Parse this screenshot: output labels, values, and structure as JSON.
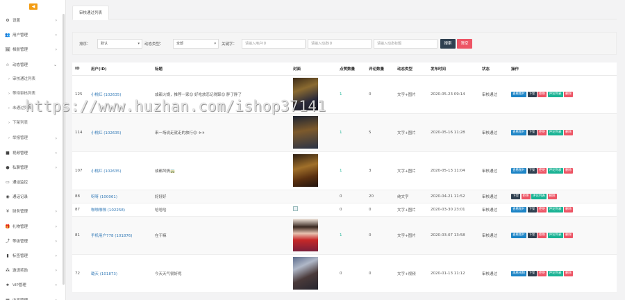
{
  "sidebar": {
    "collapse_icon": "◀",
    "items": [
      {
        "icon": "⚙",
        "label": "设置",
        "arrow": "›",
        "sub": false
      },
      {
        "icon": "👥",
        "label": "用户管理",
        "arrow": "›",
        "sub": false
      },
      {
        "icon": "🖼",
        "label": "相册管理",
        "arrow": "›",
        "sub": false
      },
      {
        "icon": "☆",
        "label": "动态管理",
        "arrow": "⌄",
        "sub": false
      },
      {
        "icon": "›",
        "label": "审核通过列表",
        "arrow": "",
        "sub": true
      },
      {
        "icon": "›",
        "label": "等待审核列表",
        "arrow": "",
        "sub": true
      },
      {
        "icon": "›",
        "label": "未通过列表",
        "arrow": "",
        "sub": true
      },
      {
        "icon": "›",
        "label": "下架列表",
        "arrow": "",
        "sub": true
      },
      {
        "icon": "›",
        "label": "举报管理",
        "arrow": "›",
        "sub": true
      },
      {
        "icon": "■",
        "label": "视频管理",
        "arrow": "›",
        "sub": false
      },
      {
        "icon": "●",
        "label": "私聊管理",
        "arrow": "›",
        "sub": false
      },
      {
        "icon": "▭",
        "label": "通话监控",
        "arrow": "",
        "sub": false
      },
      {
        "icon": "◉",
        "label": "通话记录",
        "arrow": "",
        "sub": false
      },
      {
        "icon": "¥",
        "label": "财务管理",
        "arrow": "›",
        "sub": false
      },
      {
        "icon": "🎁",
        "label": "礼物管理",
        "arrow": "›",
        "sub": false
      },
      {
        "icon": "⤴",
        "label": "等级管理",
        "arrow": "›",
        "sub": false
      },
      {
        "icon": "▮",
        "label": "标签管理",
        "arrow": "›",
        "sub": false
      },
      {
        "icon": "⁂",
        "label": "邀请奖励",
        "arrow": "›",
        "sub": false
      },
      {
        "icon": "★",
        "label": "VIP管理",
        "arrow": "›",
        "sub": false
      },
      {
        "icon": "▦",
        "label": "内容管理",
        "arrow": "›",
        "sub": false
      }
    ]
  },
  "tab": {
    "label": "审核通过列表"
  },
  "filter": {
    "sort_label": "排序：",
    "sort_value": "默认",
    "type_label": "动态类型：",
    "type_value": "全部",
    "keyword_label": "关键字：",
    "user_placeholder": "请输入用户ID",
    "id_placeholder": "请输入动态ID",
    "title_placeholder": "请输入动态标题",
    "search_label": "搜索",
    "clear_label": "清空",
    "caret": "▾"
  },
  "table": {
    "columns": [
      "ID",
      "用户(ID)",
      "标题",
      "封面",
      "点赞数量",
      "评论数量",
      "动态类型",
      "发布时间",
      "状态",
      "操作"
    ],
    "rows": [
      {
        "id": "125",
        "user": "小桃红 (102635)",
        "title": "成都火锅，推荐一家😊 好吃放恋记得踩😊 胖了胖了",
        "cover": "c1",
        "likes": "1",
        "comments": "0",
        "type": "文字+图片",
        "time": "2020-05-23 09:14",
        "status": "审核通过",
        "ops": [
          "查看图片",
          "下架",
          "拒绝",
          "评论列表",
          "删除"
        ]
      },
      {
        "id": "114",
        "user": "小桃红 (102635)",
        "title": "来一场说走就走的旅行😊 ✈✈",
        "cover": "c2",
        "likes": "1",
        "comments": "5",
        "type": "文字+图片",
        "time": "2020-05-16 11:28",
        "status": "审核通过",
        "ops": [
          "查看图片",
          "下架",
          "拒绝",
          "评论列表",
          "删除"
        ]
      },
      {
        "id": "107",
        "user": "小桃红 (102635)",
        "title": "成都风情🚃",
        "cover": "c3",
        "likes": "1",
        "comments": "3",
        "type": "文字+图片",
        "time": "2020-05-13 11:04",
        "status": "审核通过",
        "ops": [
          "查看图片",
          "下架",
          "拒绝",
          "评论列表",
          "删除"
        ]
      },
      {
        "id": "88",
        "user": "呀呀 (100061)",
        "title": "好好好",
        "cover": "",
        "likes": "0",
        "comments": "20",
        "type": "纯文字",
        "time": "2020-04-21 11:52",
        "status": "审核通过",
        "ops": [
          "下架",
          "拒绝",
          "评论列表",
          "删除"
        ]
      },
      {
        "id": "87",
        "user": "啪啪啪啪 (102258)",
        "title": "哈哈哈",
        "cover": "broken",
        "likes": "0",
        "comments": "0",
        "type": "文字+图片",
        "time": "2020-03-30 23:01",
        "status": "审核通过",
        "ops": [
          "查看图片",
          "下架",
          "拒绝",
          "评论列表",
          "删除"
        ]
      },
      {
        "id": "81",
        "user": "手机用户778 (101876)",
        "title": "在干嘛",
        "cover": "c4",
        "likes": "1",
        "comments": "0",
        "type": "文字+图片",
        "time": "2020-03-07 13:58",
        "status": "审核通过",
        "ops": [
          "查看图片",
          "下架",
          "拒绝",
          "评论列表",
          "删除"
        ]
      },
      {
        "id": "72",
        "user": "璐天 (101873)",
        "title": "今天天气很好呢",
        "cover": "c5",
        "likes": "0",
        "comments": "0",
        "type": "文字+视频",
        "time": "2020-01-13 11:12",
        "status": "审核通过",
        "ops": [
          "观看视频",
          "下架",
          "拒绝",
          "评论列表",
          "删除"
        ]
      }
    ]
  },
  "watermark": "https://www.huzhan.com/ishop37141",
  "colors": {
    "primary_dark": "#2f4050",
    "danger": "#ed5565",
    "success": "#1ab394",
    "info": "#1c84c6",
    "accent": "#f39c12"
  }
}
